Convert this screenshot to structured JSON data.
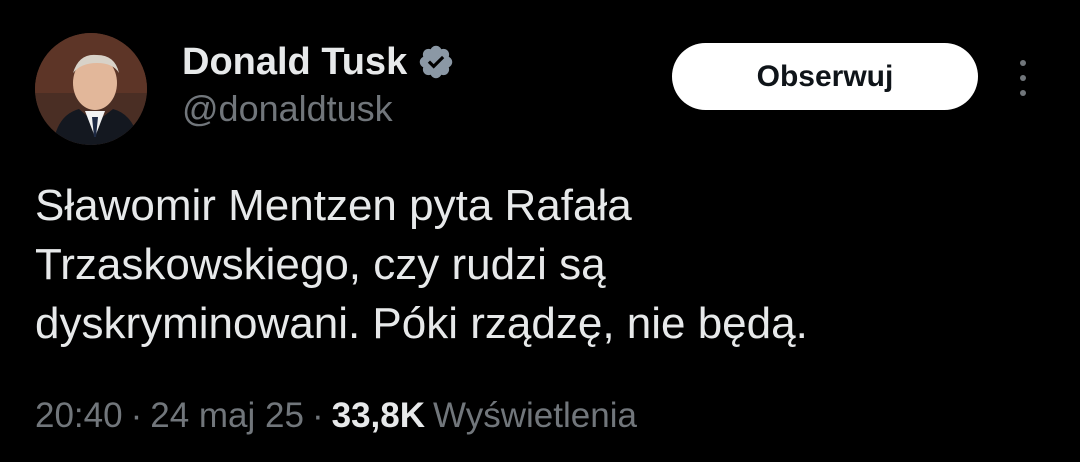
{
  "author": {
    "name": "Donald Tusk",
    "handle": "@donaldtusk",
    "verified": true,
    "verified_icon": "verified-badge-icon",
    "avatar_icon": "avatar-photo"
  },
  "actions": {
    "follow_label": "Obserwuj",
    "more_icon": "more-vertical-icon"
  },
  "tweet": {
    "text_lines": [
      "Sławomir Mentzen pyta Rafała",
      "Trzaskowskiego, czy rudzi są",
      "dyskryminowani. Póki rządzę, nie będą."
    ]
  },
  "meta": {
    "time": "20:40",
    "separator": "·",
    "date": "24 maj 25",
    "views_count": "33,8K",
    "views_label": "Wyświetlenia"
  },
  "colors": {
    "background": "#000000",
    "primary_text": "#e7e9ea",
    "secondary_text": "#71767b",
    "verified_badge": "#8b98a5",
    "follow_button_bg": "#ffffff",
    "follow_button_text": "#0f1419"
  }
}
